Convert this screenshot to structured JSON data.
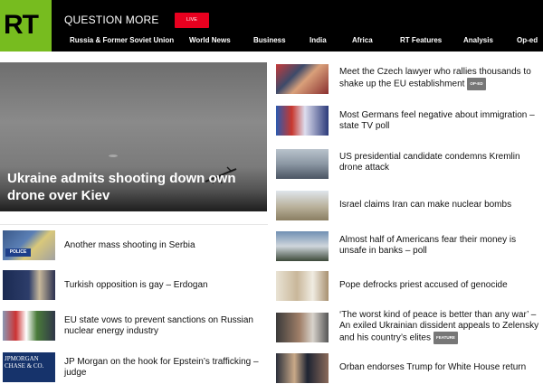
{
  "header": {
    "logo": "RT",
    "tagline": "QUESTION MORE",
    "live_label": "LIVE",
    "nav": [
      "Russia & Former Soviet Union",
      "World News",
      "Business",
      "India",
      "Africa",
      "RT Features",
      "Analysis",
      "Op-ed"
    ]
  },
  "hero": {
    "title": "Ukraine admits shooting down own drone over Kiev"
  },
  "left_items": [
    {
      "title": "Another mass shooting in Serbia",
      "thumb_text": "POLICE"
    },
    {
      "title": "Turkish opposition is gay – Erdogan"
    },
    {
      "title": "EU state vows to prevent sanctions on Russian nuclear energy industry"
    },
    {
      "title": "JP Morgan on the hook for Epstein’s trafficking – judge",
      "thumb_text": "JPMORGAN CHASE & CO."
    }
  ],
  "right_items": [
    {
      "title": "Meet the Czech lawyer who rallies thousands to shake up the EU establishment",
      "badge": "OP-ED"
    },
    {
      "title": "Most Germans feel negative about immigration – state TV poll"
    },
    {
      "title": "US presidential candidate condemns Kremlin drone attack"
    },
    {
      "title": "Israel claims Iran can make nuclear bombs"
    },
    {
      "title": "Almost half of Americans fear their money is unsafe in banks – poll"
    },
    {
      "title": "Pope defrocks priest accused of genocide"
    },
    {
      "title": "‘The worst kind of peace is better than any war’ – An exiled Ukrainian dissident appeals to Zelensky and his country’s elites",
      "badge": "FEATURE"
    },
    {
      "title": "Orban endorses Trump for White House return"
    }
  ],
  "colors": {
    "brand_green": "#77bc1f",
    "live_red": "#e8001f",
    "header_bg": "#000000"
  }
}
